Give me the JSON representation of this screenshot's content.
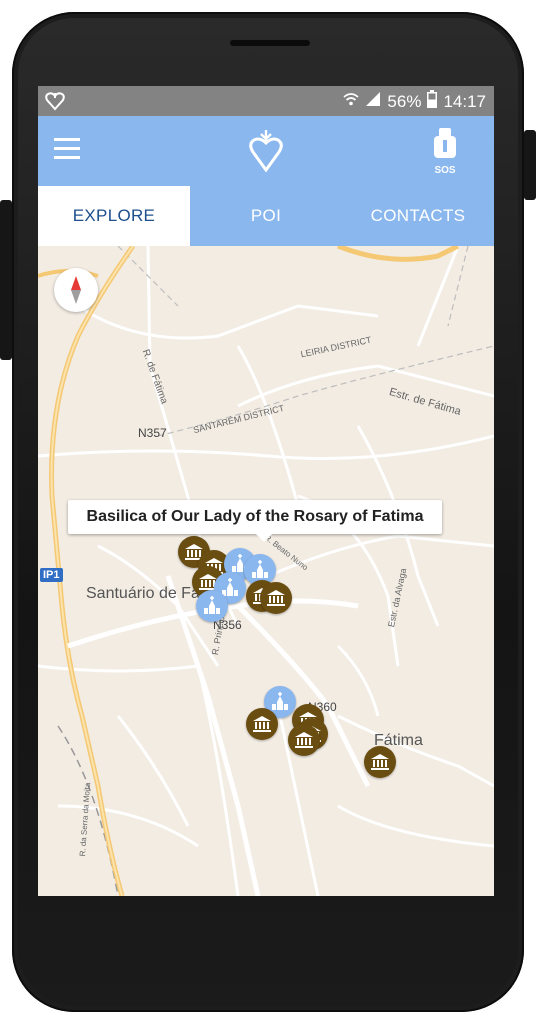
{
  "status_bar": {
    "battery": "56%",
    "time": "14:17"
  },
  "app_bar": {
    "menu_icon": "hamburger-menu-icon",
    "logo_icon": "heart-logo-icon",
    "sos_label": "SOS"
  },
  "tabs": [
    {
      "label": "EXPLORE",
      "active": true
    },
    {
      "label": "POI",
      "active": false
    },
    {
      "label": "CONTACTS",
      "active": false
    }
  ],
  "map": {
    "callout": "Basilica of Our Lady of the Rosary of Fatima",
    "labels": {
      "santuario": "Santuário de Fá",
      "fatima": "Fátima",
      "ip1": "IP1",
      "n357": "N357",
      "n356": "N356",
      "n360": "N360",
      "r_fatima": "R. de Fátima",
      "estr_fatima": "Estr. de Fátima",
      "leiria": "LEIRIA DISTRICT",
      "santarem": "SANTARÉM DISTRICT",
      "r_principal": "R. Principal",
      "estr_alvaga": "Estr. da Alvaga",
      "beato_nuno": "R. Beato Nuno",
      "serra_moita": "R. da Serra da Moita"
    }
  },
  "colors": {
    "accent": "#8ab7ee",
    "tab_active_text": "#1c4f8c",
    "museum_marker": "#6a4d10",
    "status_bar": "#838383"
  }
}
